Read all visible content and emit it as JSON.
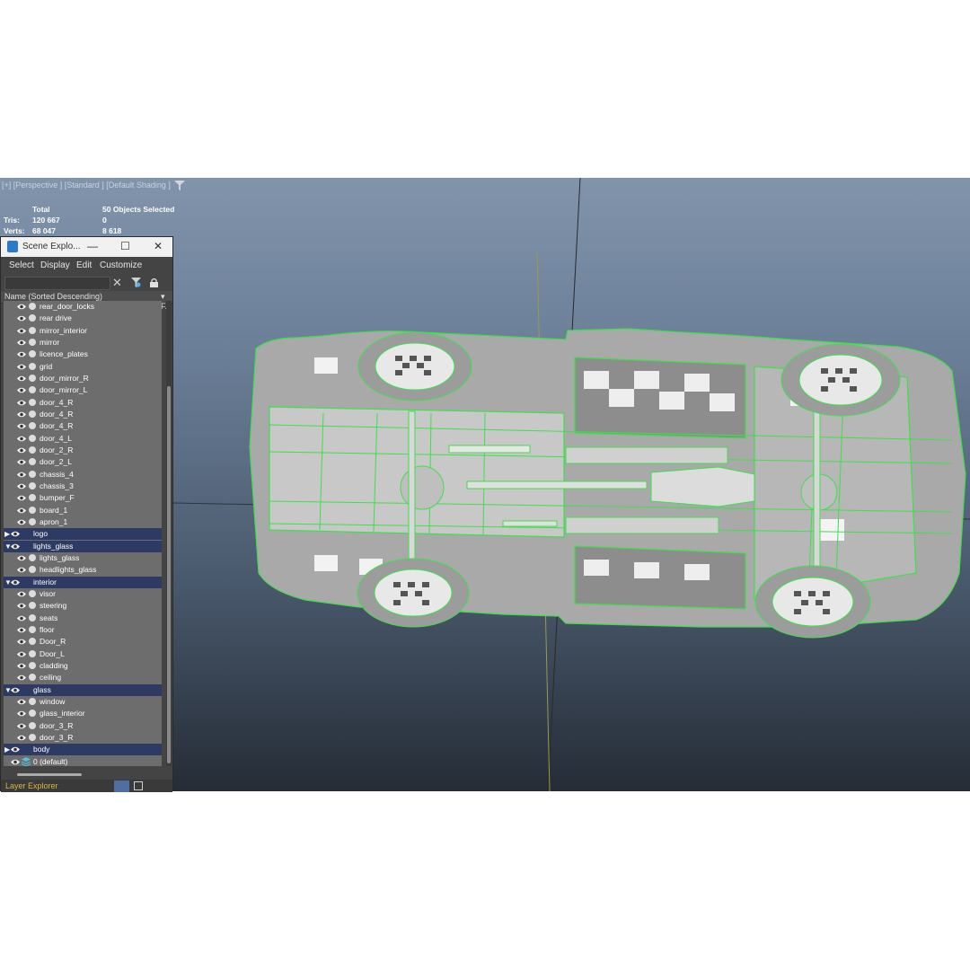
{
  "viewport": {
    "label": "[+] [Perspective ] [Standard ] [Default Shading ]",
    "stats": {
      "total_header": "Total",
      "selected_header": "50 Objects Selected",
      "tris_label": "Tris:",
      "tris_total": "120 667",
      "tris_selected": "0",
      "verts_label": "Verts:",
      "verts_total": "68 047",
      "verts_selected": "8 618"
    },
    "colors": {
      "wireframe_selection": "#3ee04a",
      "background_top": "#8194ac",
      "background_bottom": "#252c36"
    }
  },
  "explorer": {
    "title": "Scene Explo...",
    "window_controls": {
      "minimize": "—",
      "maximize": "☐",
      "close": "✕"
    },
    "menu": [
      "Select",
      "Display",
      "Edit",
      "Customize"
    ],
    "column_header": "Name (Sorted Descending)",
    "column_frozen": "▾ F..",
    "rows": [
      {
        "label": "rear_door_locks",
        "layer": false
      },
      {
        "label": "rear drive",
        "layer": false
      },
      {
        "label": "mirror_interior",
        "layer": false
      },
      {
        "label": "mirror",
        "layer": false
      },
      {
        "label": "licence_plates",
        "layer": false
      },
      {
        "label": "grid",
        "layer": false
      },
      {
        "label": "door_mirror_R",
        "layer": false
      },
      {
        "label": "door_mirror_L",
        "layer": false
      },
      {
        "label": "door_4_R",
        "layer": false
      },
      {
        "label": "door_4_R",
        "layer": false
      },
      {
        "label": "door_4_R",
        "layer": false
      },
      {
        "label": "door_4_L",
        "layer": false
      },
      {
        "label": "door_2_R",
        "layer": false
      },
      {
        "label": "door_2_L",
        "layer": false
      },
      {
        "label": "chassis_4",
        "layer": false
      },
      {
        "label": "chassis_3",
        "layer": false
      },
      {
        "label": "bumper_F",
        "layer": false
      },
      {
        "label": "board_1",
        "layer": false
      },
      {
        "label": "apron_1",
        "layer": false
      },
      {
        "label": "logo",
        "layer": true,
        "expanded": false
      },
      {
        "label": "lights_glass",
        "layer": true,
        "expanded": true
      },
      {
        "label": "lights_glass",
        "layer": false
      },
      {
        "label": "headlights_glass",
        "layer": false
      },
      {
        "label": "interior",
        "layer": true,
        "expanded": true
      },
      {
        "label": "visor",
        "layer": false
      },
      {
        "label": "steering",
        "layer": false
      },
      {
        "label": "seats",
        "layer": false
      },
      {
        "label": "floor",
        "layer": false
      },
      {
        "label": "Door_R",
        "layer": false
      },
      {
        "label": "Door_L",
        "layer": false
      },
      {
        "label": "cladding",
        "layer": false
      },
      {
        "label": "ceiling",
        "layer": false
      },
      {
        "label": "glass",
        "layer": true,
        "expanded": true
      },
      {
        "label": "window",
        "layer": false
      },
      {
        "label": "glass_interior",
        "layer": false
      },
      {
        "label": "door_3_R",
        "layer": false
      },
      {
        "label": "door_3_R",
        "layer": false
      },
      {
        "label": "body",
        "layer": true,
        "expanded": false
      },
      {
        "label": "0 (default)",
        "layer": false,
        "default_layer": true
      }
    ],
    "bottom_tab": "Layer Explorer"
  }
}
